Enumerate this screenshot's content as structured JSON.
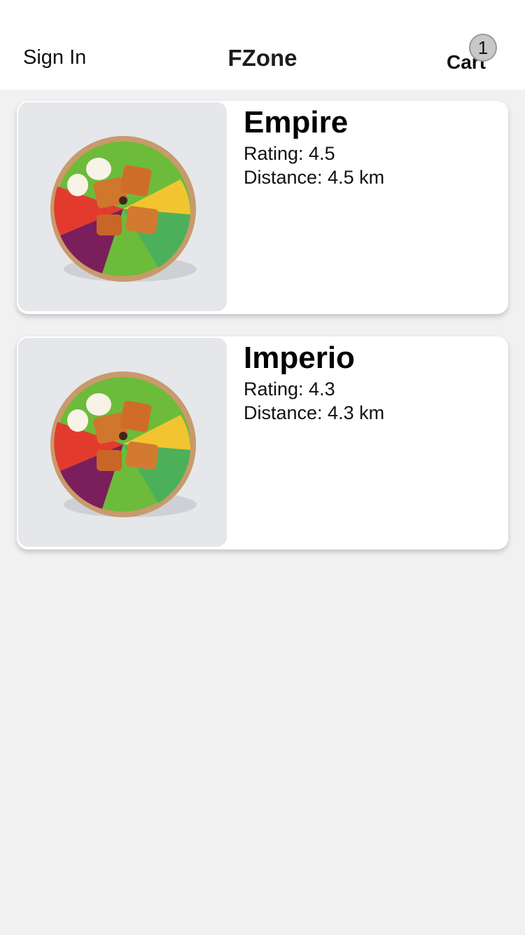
{
  "header": {
    "sign_in_label": "Sign In",
    "title": "FZone",
    "cart_label": "Cart",
    "cart_count": "1"
  },
  "restaurants": [
    {
      "name": "Empire",
      "rating": "Rating: 4.5",
      "distance": "Distance: 4.5 km",
      "image_icon": "salad-bowl-photo"
    },
    {
      "name": "Imperio",
      "rating": "Rating: 4.3",
      "distance": "Distance: 4.3 km",
      "image_icon": "salad-bowl-photo"
    }
  ],
  "colors": {
    "background": "#f1f1f1",
    "header_bg": "#ffffff",
    "card_bg": "#ffffff",
    "badge_bg": "#c8c8c8"
  }
}
